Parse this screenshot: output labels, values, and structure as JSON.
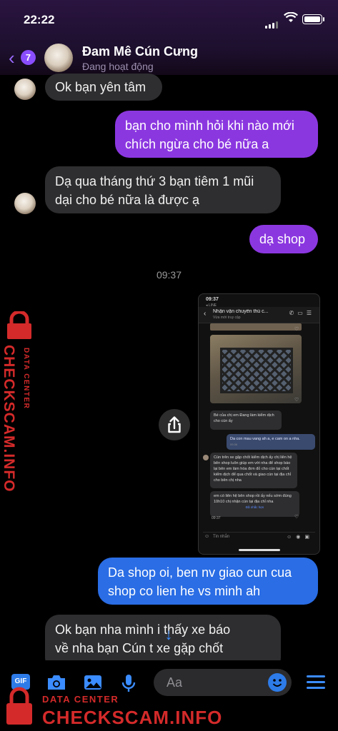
{
  "status_bar": {
    "time": "22:22"
  },
  "header": {
    "back_badge": "7",
    "contact_name": "Đam Mê Cún Cưng",
    "contact_status": "Đang hoạt động"
  },
  "messages": [
    {
      "side": "in",
      "text": "Ok bạn yên tâm"
    },
    {
      "side": "out",
      "text_line1": "bạn cho mình hỏi khi nào mới",
      "text_line2": "chích ngừa cho bé nữa a"
    },
    {
      "side": "in",
      "text_line1": "Dạ qua tháng thứ 3 bạn tiêm 1 mũi",
      "text_line2": "dại cho bé nữa là được ạ"
    },
    {
      "side": "out",
      "text": "dạ shop"
    }
  ],
  "timestamp": "09:37",
  "shared_screenshot": {
    "status_time": "09:37",
    "status_sub": "◂ LINE",
    "chat_title": "Nhận vận chuyển thú c...",
    "chat_subtitle": "Vừa mới truy cập",
    "msg1": "Bé của chị em Đang làm kiểm dịch cho cún ấy",
    "msg2": "Da con mau vang ah a, e cam on a nha.",
    "msg2_time": "09:36",
    "msg3": "Cún trên xe gặp chốt kiểm dịch ấy chị liên hệ bên shop luôn giúp em với nha để shop báo lại bên em làm hóa đơn đỏ cho cún tại chốt kiểm dịch để qua chốt và giao cún tại địa chỉ cho bên chị nha",
    "msg4": "em có liên hệ bên shop rồi ấy nếu sớm đúng 10h10 chị nhận cún tại địa chỉ nha",
    "msg4_link": "Đã nhắc hẹn",
    "msg4_time": "09:37",
    "input_placeholder": "Tin nhắn"
  },
  "messages_after": [
    {
      "side": "out",
      "text_line1": "Da shop oi, ben nv giao cun cua",
      "text_line2": "shop co lien he vs minh ah"
    },
    {
      "side": "in",
      "text_line1": "Ok bạn nha mình   i thấy xe báo",
      "text_line2": "về nha bạn Cún t    xe gặp chốt"
    }
  ],
  "composer": {
    "gif_label": "GIF",
    "placeholder": "Aa"
  },
  "watermark": {
    "brand": "CHECKSCAM.INFO",
    "tagline": "DATA CENTER"
  },
  "colors": {
    "accent": "#8b37e0",
    "outgoing_blue": "#2a6de5",
    "incoming": "#2e2e30",
    "icon_blue": "#3b8cff",
    "watermark_red": "#d42a2a"
  }
}
